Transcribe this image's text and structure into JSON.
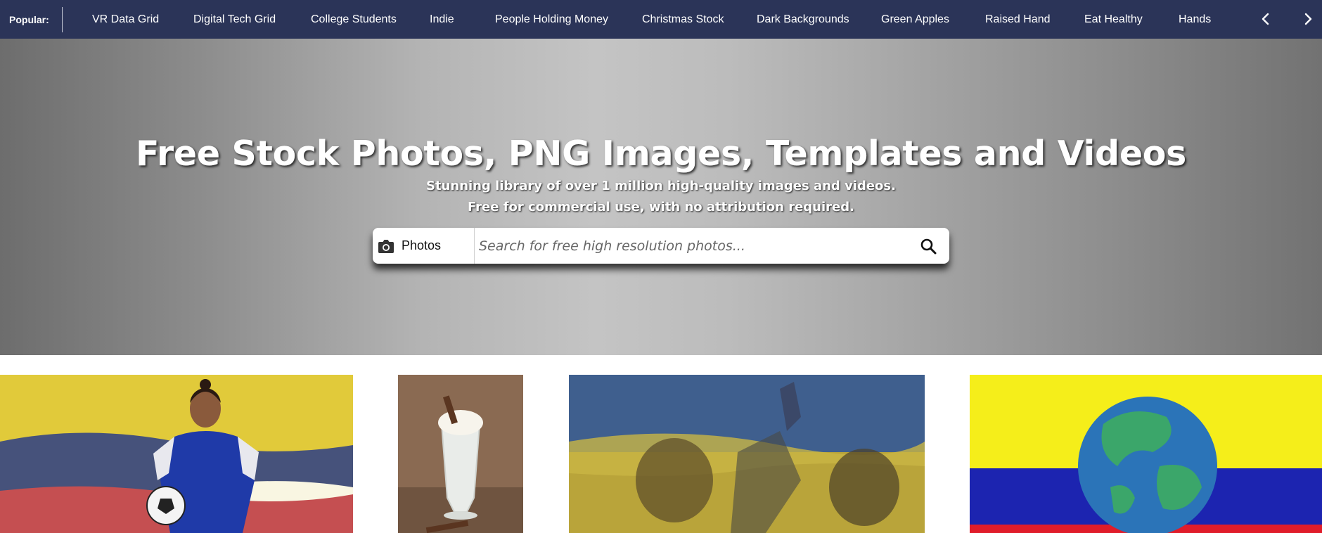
{
  "popular": {
    "label": "Popular:",
    "items": [
      "VR Data Grid",
      "Digital Tech Grid",
      "College Students",
      "Indie",
      "People Holding Money",
      "Christmas Stock",
      "Dark Backgrounds",
      "Green Apples",
      "Raised Hand",
      "Eat Healthy",
      "Hands"
    ],
    "prev_icon": "chevron-left-icon",
    "next_icon": "chevron-right-icon"
  },
  "hero": {
    "title": "Free Stock Photos, PNG Images, Templates and Videos",
    "subtitle_line1": "Stunning library of over 1 million high-quality images and videos.",
    "subtitle_line2": "Free for commercial use, with no attribution required."
  },
  "search": {
    "type_icon": "camera-icon",
    "type_label": "Photos",
    "placeholder": "Search for free high resolution photos...",
    "value": "",
    "button_icon": "search-icon"
  },
  "thumbnails": [
    {
      "subject": "woman-with-soccer-ball-colombia-flag"
    },
    {
      "subject": "milkshake-glass"
    },
    {
      "subject": "people-cheering-ukraine-flag"
    },
    {
      "subject": "globe-colombia-flag"
    }
  ],
  "colors": {
    "topbar_bg": "#2b3458",
    "hero_gradient_center": "#c4c4c4",
    "hero_gradient_edge": "#6d6d6d"
  }
}
